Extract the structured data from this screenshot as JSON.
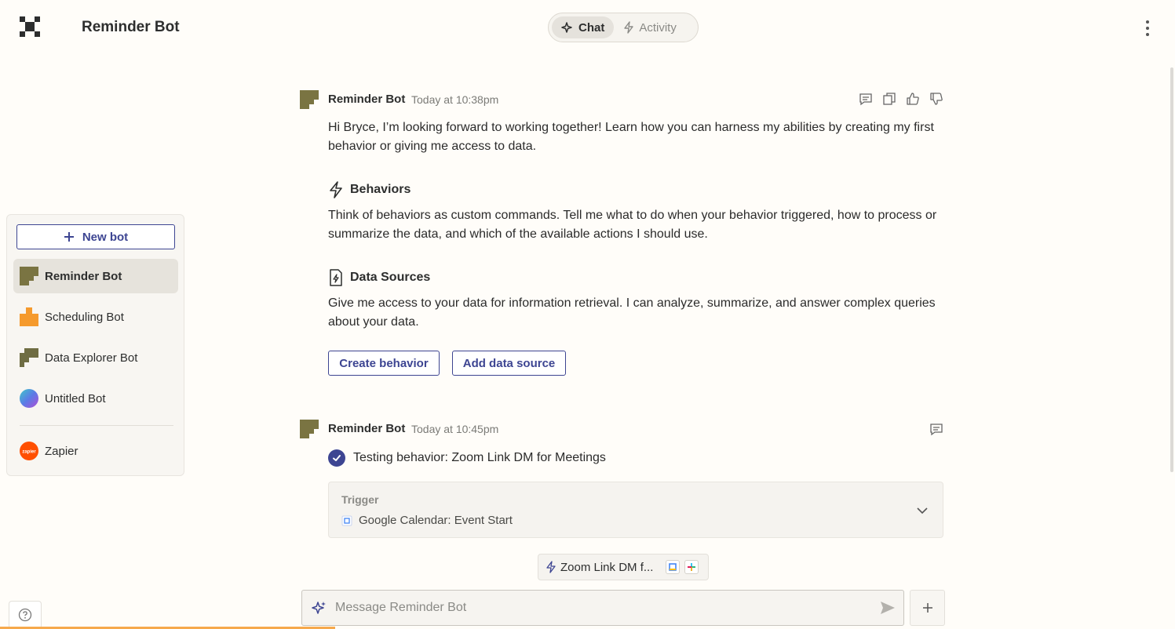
{
  "header": {
    "title": "Reminder Bot",
    "tabs": [
      {
        "label": "Chat",
        "icon": "sparkle-icon",
        "active": true
      },
      {
        "label": "Activity",
        "icon": "bolt-icon",
        "active": false
      }
    ]
  },
  "sidebar": {
    "new_bot_label": "New bot",
    "bots": [
      {
        "label": "Reminder Bot",
        "color": "#7a7442",
        "active": true
      },
      {
        "label": "Scheduling Bot",
        "color": "#f59a2d",
        "active": false
      },
      {
        "label": "Data Explorer Bot",
        "color": "#6f6d43",
        "active": false
      },
      {
        "label": "Untitled Bot",
        "color": "gradient",
        "active": false
      }
    ],
    "zapier": {
      "label": "Zapier",
      "badge_text": "zapier",
      "color": "#ff4f00"
    }
  },
  "messages": [
    {
      "author": "Reminder Bot",
      "time": "Today at 10:38pm",
      "intro": "Hi Bryce, I’m looking forward to working together! Learn how you can harness my abilities by creating my first behavior or giving me access to data.",
      "behaviors_title": "Behaviors",
      "behaviors_text": "Think of behaviors as custom commands. Tell me what to do when your behavior triggered, how to process or summarize the data, and which of the available actions I should use.",
      "data_sources_title": "Data Sources",
      "data_sources_text": "Give me access to your data for information retrieval. I can analyze, summarize, and answer complex queries about your data.",
      "create_behavior_label": "Create behavior",
      "add_data_source_label": "Add data source"
    },
    {
      "author": "Reminder Bot",
      "time": "Today at 10:45pm",
      "status": "Testing behavior: Zoom Link DM for Meetings",
      "trigger_label": "Trigger",
      "trigger_value": "Google Calendar: Event Start"
    }
  ],
  "chip": {
    "label": "Zoom Link DM f..."
  },
  "composer": {
    "placeholder": "Message Reminder Bot"
  },
  "colors": {
    "accent": "#3d4592",
    "background": "#fffdf9",
    "brand_bot": "#7a7442"
  }
}
